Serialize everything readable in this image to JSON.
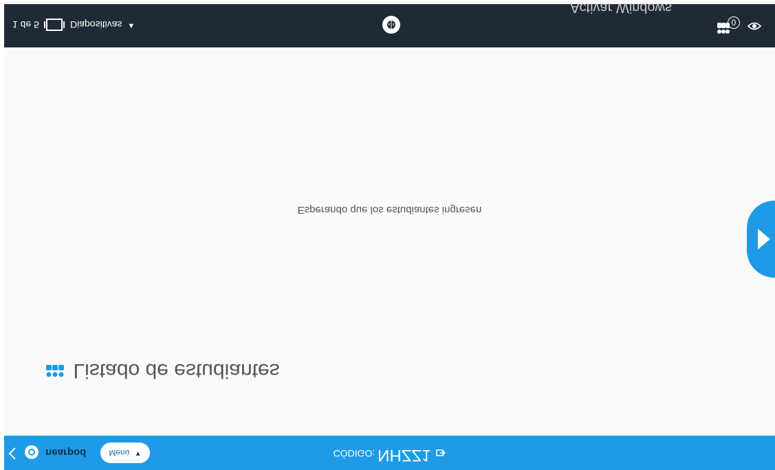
{
  "watermark": "Activar Windows",
  "topbar": {
    "slide_counter": "1 de 5",
    "device_label": "Diapositivas",
    "student_count": "0"
  },
  "main": {
    "waiting_message": "Esperando que los estudiantes ingresen",
    "student_list_title": "Listado de estudiantes"
  },
  "bottombar": {
    "brand": "nearpod",
    "menu_label": "Menú",
    "code_label": "CÓDIGO:",
    "code_value": "NHZZ1"
  },
  "colors": {
    "topbar": "#1f2a36",
    "accent": "#1e9ae6",
    "background": "#fafafa"
  },
  "icons": [
    "screen-icon",
    "brain-icon",
    "students-icon",
    "eye-icon",
    "next-arrow-icon",
    "back-chevron-icon",
    "nearpod-logo-icon",
    "copy-icon"
  ]
}
